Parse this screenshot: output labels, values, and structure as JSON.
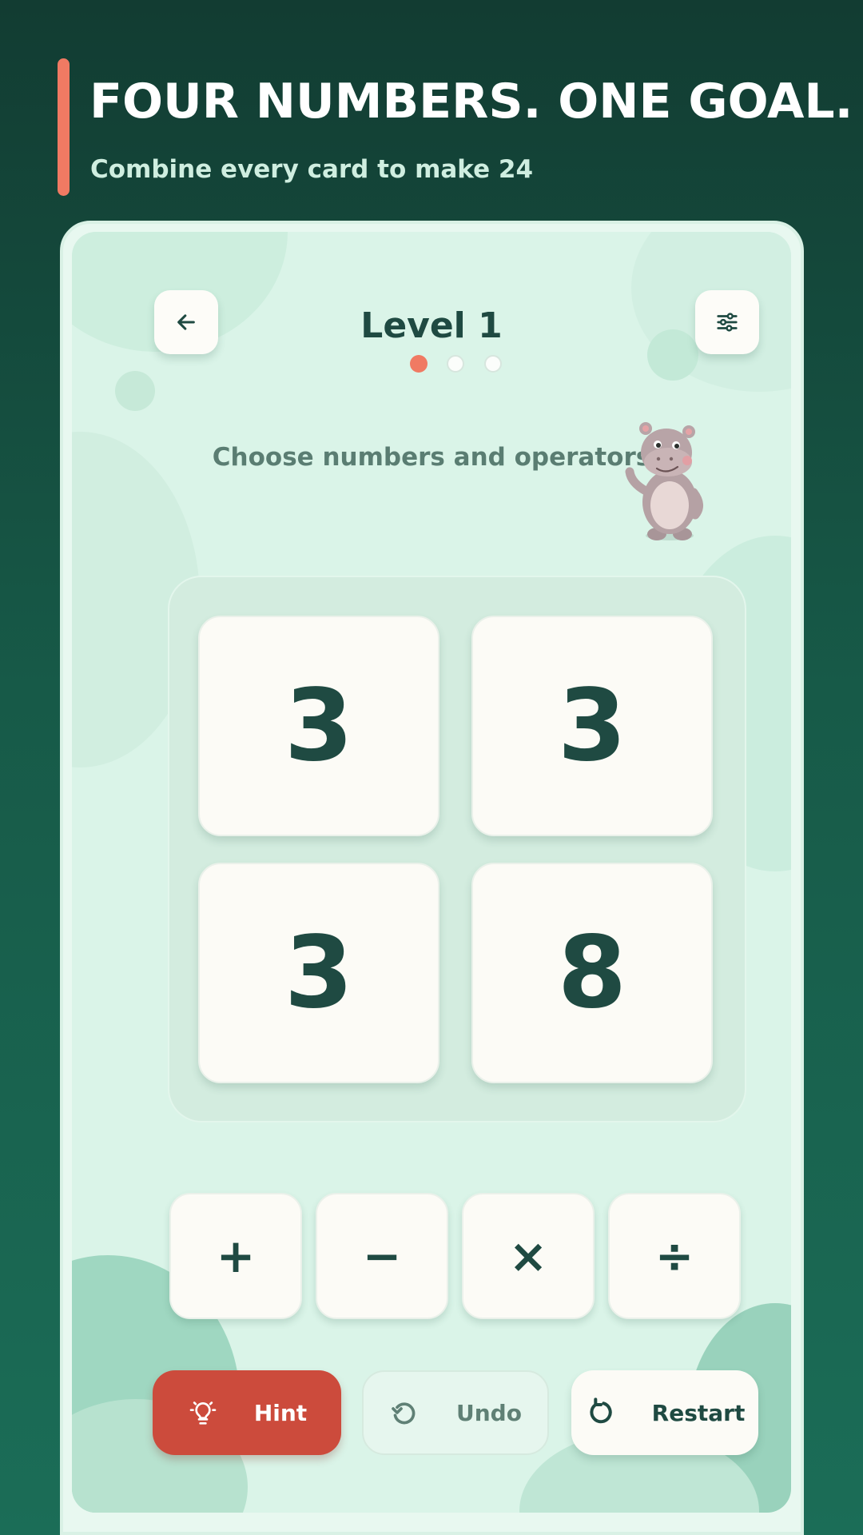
{
  "header": {
    "title": "FOUR NUMBERS. ONE GOAL.",
    "subtitle": "Combine every card to make 24"
  },
  "game": {
    "level_title": "Level 1",
    "progress": {
      "current": 1,
      "total": 3
    },
    "instruction": "Choose numbers and operators",
    "mascot": "hippo-mascot",
    "cards": [
      "3",
      "3",
      "3",
      "8"
    ],
    "operators": [
      "+",
      "−",
      "×",
      "÷"
    ]
  },
  "actions": {
    "hint": {
      "label": "Hint",
      "icon": "lightbulb-icon"
    },
    "undo": {
      "label": "Undo",
      "icon": "undo-icon"
    },
    "restart": {
      "label": "Restart",
      "icon": "restart-icon"
    }
  },
  "icons": {
    "back": "arrow-left-icon",
    "settings": "sliders-icon"
  },
  "colors": {
    "accent": "#f07a63",
    "hint_button": "#cc4b3c",
    "text_dark": "#1f4a42",
    "background_dark": "#123c32",
    "screen": "#daf4e8"
  }
}
